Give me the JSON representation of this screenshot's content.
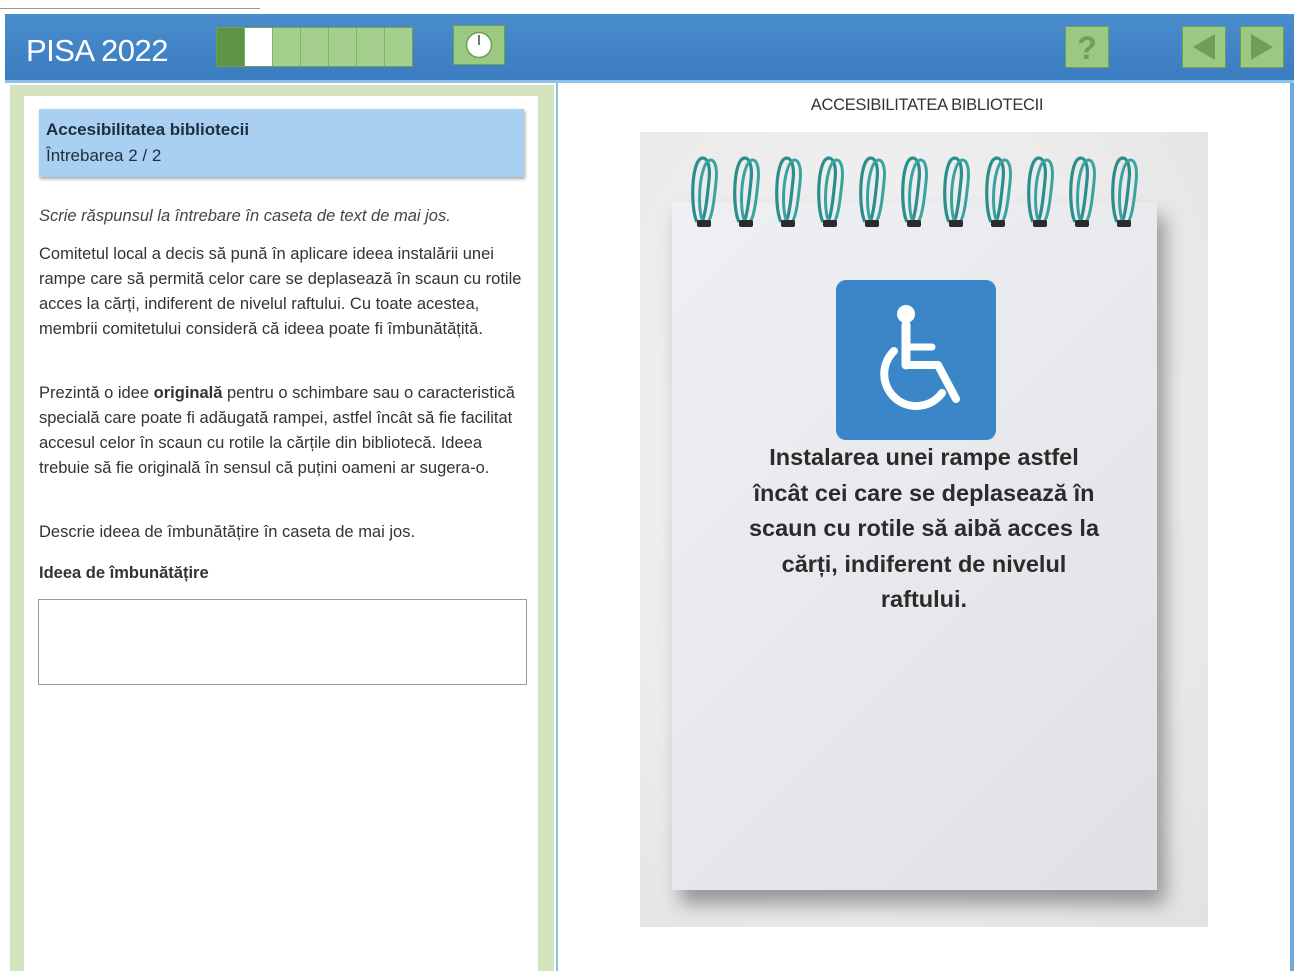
{
  "header": {
    "app_title": "PISA 2022",
    "progress": {
      "total_units": 7,
      "completed_units": 1,
      "current_unit": 2
    },
    "timer_icon": "clock-icon",
    "help_icon": "question-mark-icon",
    "back_icon": "arrow-left-icon",
    "next_icon": "arrow-right-icon",
    "colors": {
      "bar": "#3a7cc0",
      "button": "#9bc981"
    }
  },
  "question": {
    "title": "Accesibilitatea bibliotecii",
    "number": "Întrebarea 2 / 2",
    "instruction": "Scrie răspunsul la întrebare în caseta de text de mai jos.",
    "paragraph1": "Comitetul local a decis să pună în aplicare ideea instalării unei rampe care să permită celor care se deplasează în scaun cu rotile acces la cărți, indiferent de nivelul raftului. Cu toate acestea, membrii comitetului consideră că ideea poate fi îmbunătățită.",
    "paragraph2_before": "Prezintă o idee ",
    "paragraph2_bold": "originală",
    "paragraph2_after": " pentru o schimbare sau o caracteristică specială care poate fi adăugată rampei, astfel încât să fie facilitat accesul celor în scaun cu rotile la cărțile din bibliotecă. Ideea trebuie să fie originală în sensul că puțini oameni ar sugera-o.",
    "paragraph3": "Descrie ideea de îmbunătățire în caseta de mai jos.",
    "answer_label": "Ideea de îmbunătățire",
    "answer_value": "",
    "answer_placeholder": ""
  },
  "stimulus": {
    "title": "ACCESIBILITATEA BIBLIOTECII",
    "image_icon": "wheelchair-icon",
    "notebook_text": "Instalarea unei rampe astfel încât cei care se deplasează în scaun cu rotile să aibă acces la cărți, indiferent de nivelul raftului."
  }
}
